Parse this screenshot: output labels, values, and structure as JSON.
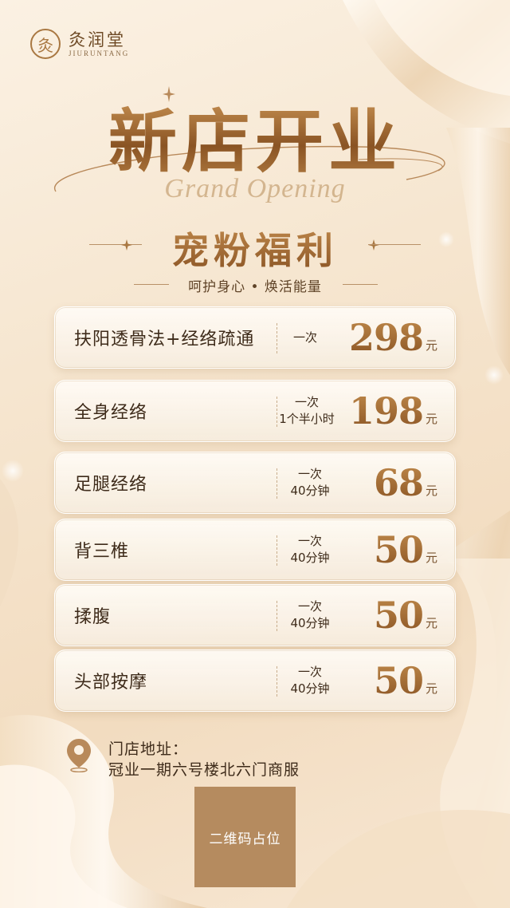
{
  "brand": {
    "logo_glyph": "灸",
    "name_cn": "灸润堂",
    "name_en": "JIURUNTANG"
  },
  "hero": {
    "title": "新店开业",
    "script_text": "Grand Opening",
    "subtitle": "宠粉福利",
    "tagline": "呵护身心 • 焕活能量"
  },
  "services": [
    {
      "name": "扶阳透骨法+经络疏通",
      "detail_line1": "一次",
      "detail_line2": "",
      "price": "298",
      "unit": "元"
    },
    {
      "name": "全身经络",
      "detail_line1": "一次",
      "detail_line2": "1个半小时",
      "price": "198",
      "unit": "元"
    },
    {
      "name": "足腿经络",
      "detail_line1": "一次",
      "detail_line2": "40分钟",
      "price": "68",
      "unit": "元"
    },
    {
      "name": "背三椎",
      "detail_line1": "一次",
      "detail_line2": "40分钟",
      "price": "50",
      "unit": "元"
    },
    {
      "name": "揉腹",
      "detail_line1": "一次",
      "detail_line2": "40分钟",
      "price": "50",
      "unit": "元"
    },
    {
      "name": "头部按摩",
      "detail_line1": "一次",
      "detail_line2": "40分钟",
      "price": "50",
      "unit": "元"
    }
  ],
  "address": {
    "label": "门店地址：",
    "value": "冠业一期六号楼北六门商服"
  },
  "qr_placeholder": "二维码占位",
  "colors": {
    "gold": "#9a6530",
    "text": "#3e2b1a",
    "qr_bg": "#b58b5f"
  }
}
